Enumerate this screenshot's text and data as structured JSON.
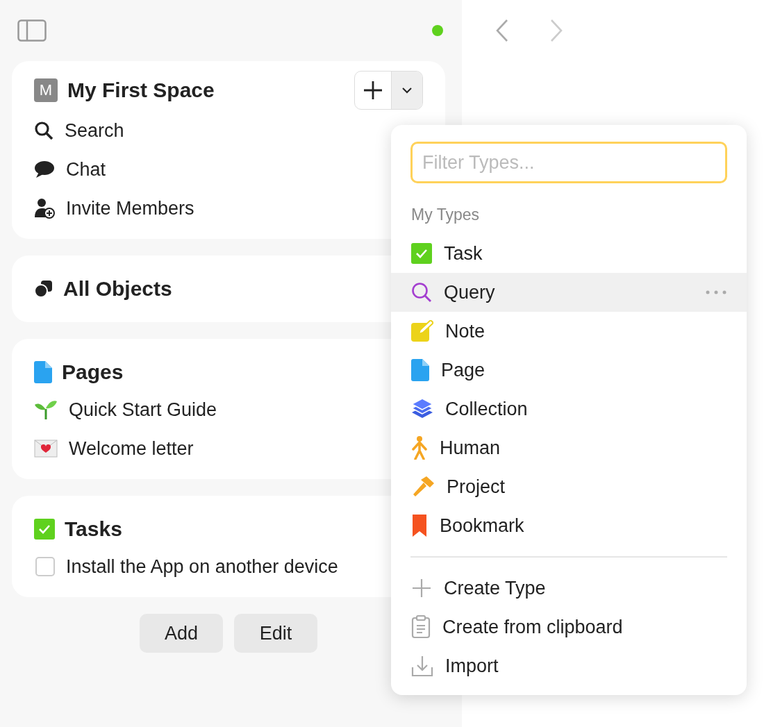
{
  "space": {
    "initial": "M",
    "name": "My First Space",
    "items": [
      {
        "kind": "search",
        "label": "Search"
      },
      {
        "kind": "chat",
        "label": "Chat"
      },
      {
        "kind": "invite",
        "label": "Invite Members"
      }
    ]
  },
  "all_objects": {
    "title": "All Objects"
  },
  "pages": {
    "title": "Pages",
    "items": [
      {
        "kind": "sprout",
        "label": "Quick Start Guide"
      },
      {
        "kind": "letter",
        "label": "Welcome letter"
      }
    ]
  },
  "tasks": {
    "title": "Tasks",
    "items": [
      {
        "label": "Install the App on another device",
        "checked": false
      }
    ]
  },
  "buttons": [
    "Add",
    "Edit"
  ],
  "menu": {
    "placeholder": "Filter Types...",
    "section": "My Types",
    "types": [
      {
        "kind": "task",
        "label": "Task",
        "selected": false
      },
      {
        "kind": "query",
        "label": "Query",
        "selected": true
      },
      {
        "kind": "note",
        "label": "Note",
        "selected": false
      },
      {
        "kind": "page",
        "label": "Page",
        "selected": false
      },
      {
        "kind": "collection",
        "label": "Collection",
        "selected": false
      },
      {
        "kind": "human",
        "label": "Human",
        "selected": false
      },
      {
        "kind": "project",
        "label": "Project",
        "selected": false
      },
      {
        "kind": "bookmark",
        "label": "Bookmark",
        "selected": false
      }
    ],
    "actions": [
      {
        "kind": "create",
        "label": "Create Type"
      },
      {
        "kind": "clipboard",
        "label": "Create from clipboard"
      },
      {
        "kind": "import",
        "label": "Import"
      }
    ]
  }
}
